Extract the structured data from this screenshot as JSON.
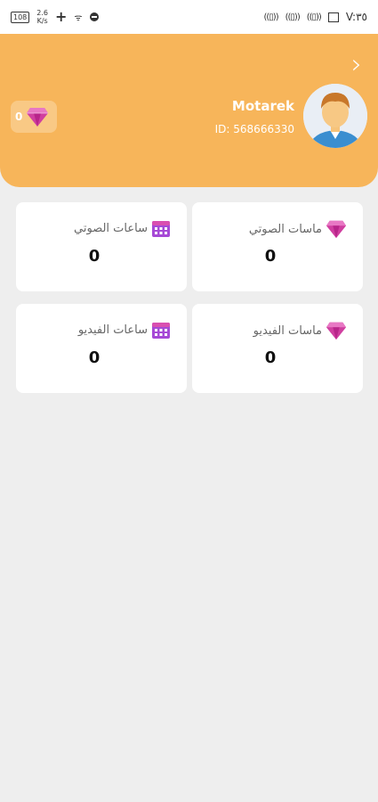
{
  "status_bar": {
    "battery": "108",
    "speed_value": "2.6",
    "speed_unit": "K/s",
    "time": "V:٣٥"
  },
  "header": {
    "user_name": "Motarek",
    "user_id": "ID: 568666330",
    "diamond_count": "0",
    "colors": {
      "background": "#f7b55a",
      "badge": "#f9c985"
    }
  },
  "cards": [
    {
      "label": "ماسات الصوتي",
      "value": "0",
      "icon": "diamond-icon"
    },
    {
      "label": "ساعات الصوتي",
      "value": "0",
      "icon": "calendar-icon"
    },
    {
      "label": "ماسات الفيديو",
      "value": "0",
      "icon": "diamond-icon"
    },
    {
      "label": "ساعات الفيديو",
      "value": "0",
      "icon": "calendar-icon"
    }
  ]
}
